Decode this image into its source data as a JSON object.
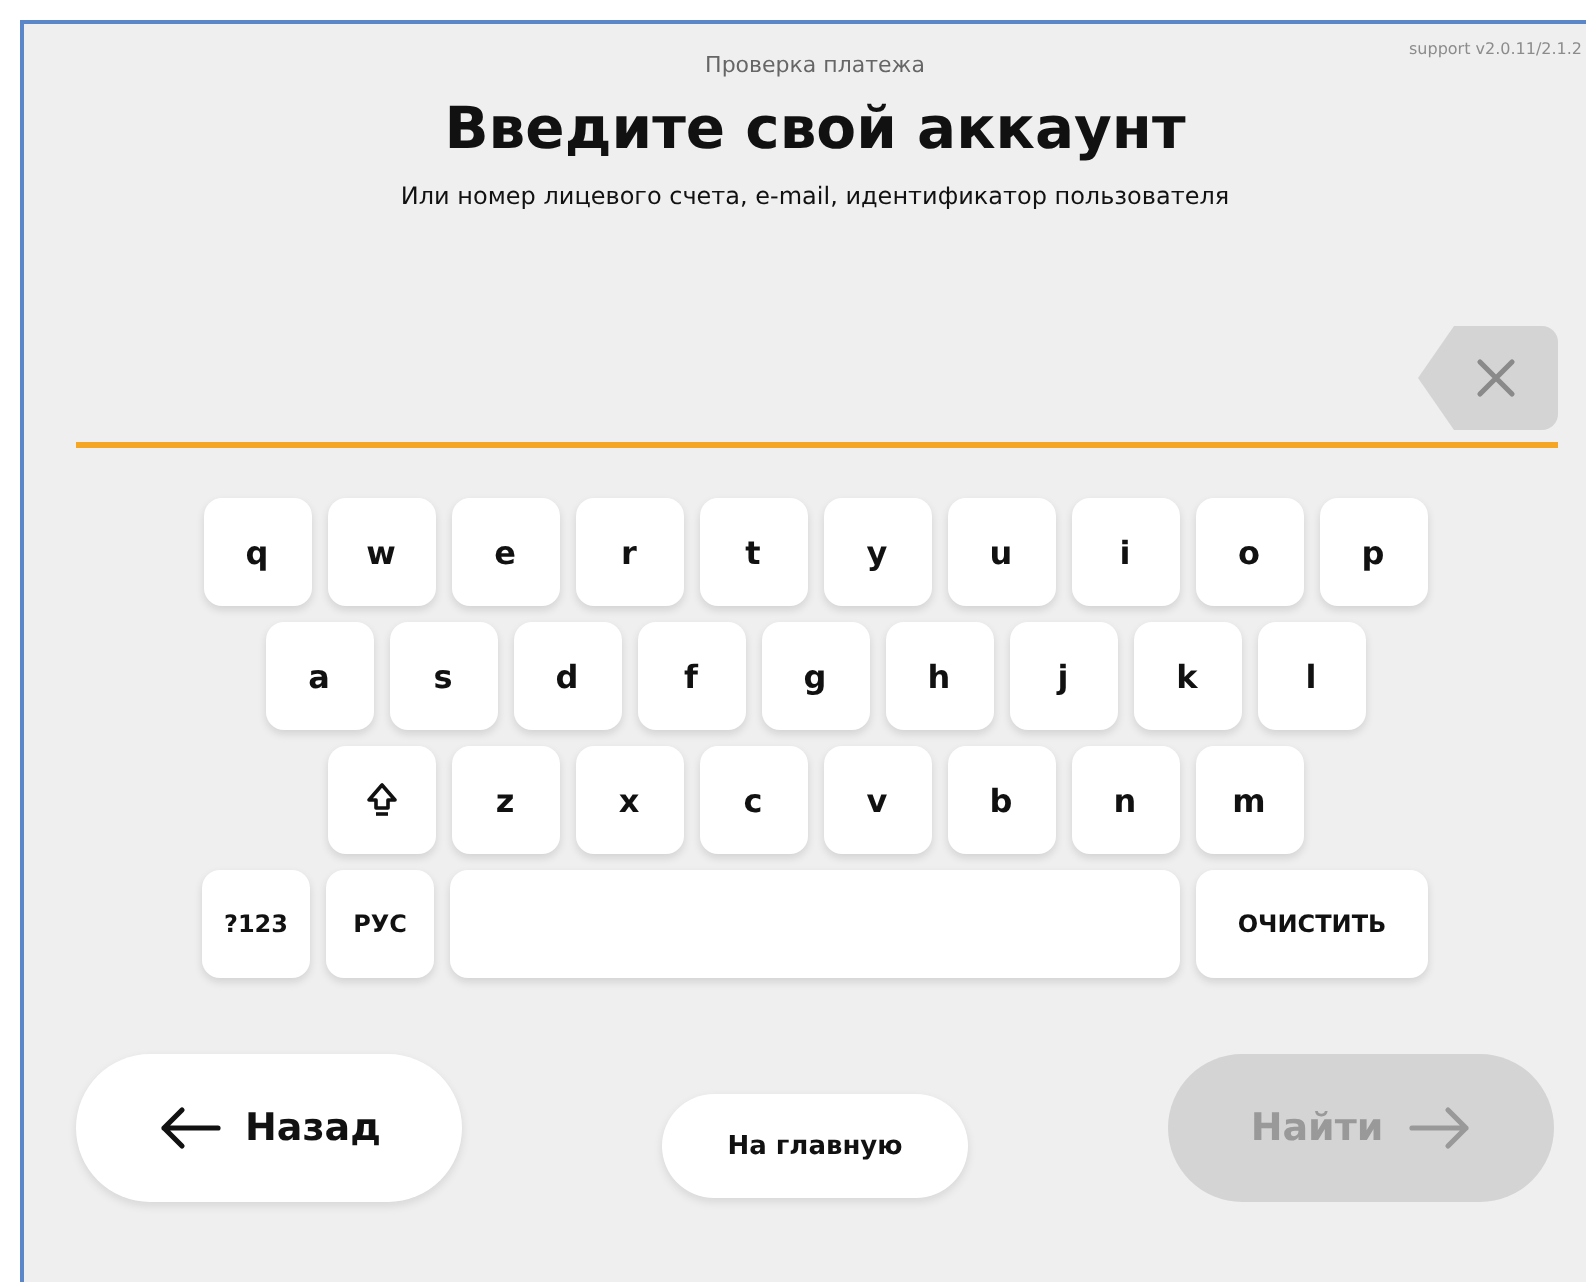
{
  "header": {
    "caption": "Проверка платежа",
    "version": "support v2.0.11/2.1.2",
    "title": "Введите свой аккаунт",
    "subtitle": "Или номер лицевого счета, e-mail, идентификатор пользователя"
  },
  "keyboard": {
    "rows": [
      {
        "keys": [
          {
            "kind": "char",
            "label": "q"
          },
          {
            "kind": "char",
            "label": "w"
          },
          {
            "kind": "char",
            "label": "e"
          },
          {
            "kind": "char",
            "label": "r"
          },
          {
            "kind": "char",
            "label": "t"
          },
          {
            "kind": "char",
            "label": "y"
          },
          {
            "kind": "char",
            "label": "u"
          },
          {
            "kind": "char",
            "label": "i"
          },
          {
            "kind": "char",
            "label": "o"
          },
          {
            "kind": "char",
            "label": "p"
          }
        ]
      },
      {
        "keys": [
          {
            "kind": "char",
            "label": "a"
          },
          {
            "kind": "char",
            "label": "s"
          },
          {
            "kind": "char",
            "label": "d"
          },
          {
            "kind": "char",
            "label": "f"
          },
          {
            "kind": "char",
            "label": "g"
          },
          {
            "kind": "char",
            "label": "h"
          },
          {
            "kind": "char",
            "label": "j"
          },
          {
            "kind": "char",
            "label": "k"
          },
          {
            "kind": "char",
            "label": "l"
          }
        ]
      },
      {
        "keys": [
          {
            "kind": "shift"
          },
          {
            "kind": "char",
            "label": "z"
          },
          {
            "kind": "char",
            "label": "x"
          },
          {
            "kind": "char",
            "label": "c"
          },
          {
            "kind": "char",
            "label": "v"
          },
          {
            "kind": "char",
            "label": "b"
          },
          {
            "kind": "char",
            "label": "n"
          },
          {
            "kind": "char",
            "label": "m"
          }
        ]
      },
      {
        "keys": [
          {
            "kind": "mode",
            "label": "?123"
          },
          {
            "kind": "mode",
            "label": "РУС"
          },
          {
            "kind": "space"
          },
          {
            "kind": "wide",
            "label": "ОЧИСТИТЬ"
          }
        ]
      }
    ]
  },
  "buttons": {
    "back": {
      "label": "Назад",
      "disabled": false
    },
    "home": {
      "label": "На главную",
      "disabled": false
    },
    "find": {
      "label": "Найти",
      "disabled": true
    }
  }
}
